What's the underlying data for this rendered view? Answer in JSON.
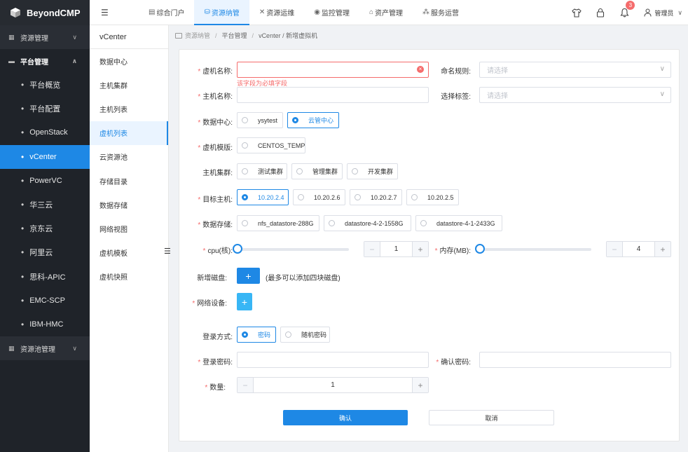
{
  "app": {
    "title": "BeyondCMP"
  },
  "sidebar": {
    "groups": [
      {
        "label": "资源管理",
        "icon": "grid-icon"
      },
      {
        "label": "平台管理",
        "icon": "monitor-icon"
      },
      {
        "label": "资源池管理",
        "icon": "grid-icon"
      }
    ],
    "items": [
      {
        "label": "平台概览"
      },
      {
        "label": "平台配置"
      },
      {
        "label": "OpenStack"
      },
      {
        "label": "vCenter"
      },
      {
        "label": "PowerVC"
      },
      {
        "label": "华三云"
      },
      {
        "label": "京东云"
      },
      {
        "label": "阿里云"
      },
      {
        "label": "思科-APIC"
      },
      {
        "label": "EMC-SCP"
      },
      {
        "label": "IBM-HMC"
      }
    ]
  },
  "topbar": {
    "tabs": [
      {
        "label": "综合门户",
        "icon": "portal-icon"
      },
      {
        "label": "资源纳管",
        "icon": "resource-icon"
      },
      {
        "label": "资源运维",
        "icon": "tools-icon"
      },
      {
        "label": "监控管理",
        "icon": "monitor-icon"
      },
      {
        "label": "资产管理",
        "icon": "home-icon"
      },
      {
        "label": "服务运营",
        "icon": "service-icon"
      }
    ],
    "notification_count": "3",
    "user": "管理员"
  },
  "subsidebar": {
    "title": "vCenter",
    "items": [
      {
        "label": "数据中心"
      },
      {
        "label": "主机集群"
      },
      {
        "label": "主机列表"
      },
      {
        "label": "虚机列表"
      },
      {
        "label": "云资源池"
      },
      {
        "label": "存储目录"
      },
      {
        "label": "数据存储"
      },
      {
        "label": "网络视图"
      },
      {
        "label": "虚机模板"
      },
      {
        "label": "虚机快照"
      }
    ]
  },
  "breadcrumb": [
    "资源纳管",
    "平台管理",
    "vCenter / 新增虚拟机"
  ],
  "form": {
    "vm_name": {
      "label": "虚机名称:",
      "value": "",
      "error": "该字段为必填字段"
    },
    "naming_rule": {
      "label": "命名规则:",
      "placeholder": "请选择"
    },
    "host_name": {
      "label": "主机名称:",
      "value": ""
    },
    "select_tag": {
      "label": "选择标签:",
      "placeholder": "请选择"
    },
    "datacenter": {
      "label": "数据中心:",
      "options": [
        "ysytest",
        "云管中心"
      ],
      "selected": "云管中心"
    },
    "template": {
      "label": "虚机模版:",
      "options": [
        "CENTOS_TEMP"
      ],
      "selected": ""
    },
    "host_cluster": {
      "label": "主机集群:",
      "options": [
        "测试集群",
        "管理集群",
        "开发集群"
      ],
      "selected": ""
    },
    "target_host": {
      "label": "目标主机:",
      "options": [
        "10.20.2.4",
        "10.20.2.6",
        "10.20.2.7",
        "10.20.2.5"
      ],
      "selected": "10.20.2.4"
    },
    "datastore": {
      "label": "数据存储:",
      "options": [
        "nfs_datastore-288G",
        "datastore-4-2-1558G",
        "datastore-4-1-2433G"
      ],
      "selected": ""
    },
    "cpu": {
      "label": "cpu(核):",
      "value": "1"
    },
    "memory": {
      "label": "内存(MB):",
      "value": "4"
    },
    "disk": {
      "label": "新增磁盘:",
      "hint": "(最多可以添加四块磁盘)"
    },
    "network": {
      "label": "网络设备:"
    },
    "login_method": {
      "label": "登录方式:",
      "options": [
        "密码",
        "随机密码"
      ],
      "selected": "密码"
    },
    "login_password": {
      "label": "登录密码:",
      "value": ""
    },
    "confirm_password": {
      "label": "确认密码:",
      "value": ""
    },
    "quantity": {
      "label": "数量:",
      "value": "1"
    },
    "confirm_button": "确认",
    "cancel_button": "取消"
  },
  "colors": {
    "primary": "#1e88e5",
    "sidebar_bg": "#1f2329",
    "error": "#f56c6c",
    "cyan": "#38b6f5"
  }
}
